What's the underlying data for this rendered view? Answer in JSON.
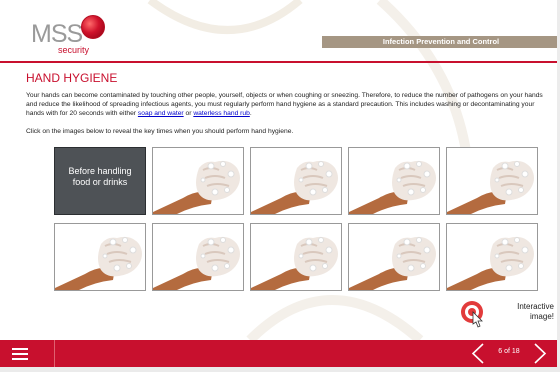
{
  "header": {
    "logo_text": "MSS",
    "logo_subtext": "security",
    "banner": "Infection Prevention and Control"
  },
  "main": {
    "title": "HAND HYGIENE",
    "paragraph": {
      "text_before": "Your hands can become contaminated by touching other people, yourself, objects or when coughing or sneezing. Therefore, to reduce the number of pathogens on your hands and reduce the likelihood of spreading infectious agents, you must regularly perform hand hygiene as a standard precaution. This includes washing or decontaminating your hands with for 20 seconds with either ",
      "link1": "soap and water",
      "text_middle": " or ",
      "link2": "waterless hand rub",
      "text_after": "."
    },
    "instruction": "Click on the images below to reveal the key times when you should perform hand hygiene.",
    "tiles": [
      {
        "label_line1": "Before handling",
        "label_line2": "food or drinks",
        "revealed": true
      },
      {
        "revealed": false
      },
      {
        "revealed": false
      },
      {
        "revealed": false
      },
      {
        "revealed": false
      },
      {
        "revealed": false
      },
      {
        "revealed": false
      },
      {
        "revealed": false
      },
      {
        "revealed": false
      },
      {
        "revealed": false
      }
    ],
    "interactive_label_line1": "Interactive",
    "interactive_label_line2": "image!"
  },
  "footer": {
    "pager": "6 of 18",
    "icons": [
      "menu-icon",
      "chevron-left-icon",
      "chevron-right-icon"
    ]
  },
  "colors": {
    "accent": "#c8102e",
    "banner": "#a59683",
    "link": "#0000cc"
  }
}
